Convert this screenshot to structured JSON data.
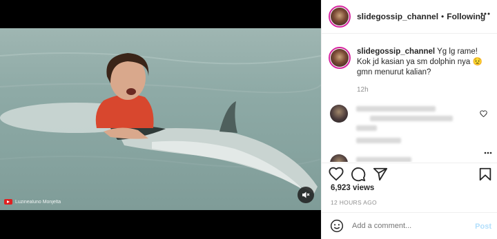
{
  "video": {
    "watermark": "Luzinealuno Monjelta",
    "icons": {
      "mute": "speaker-muted-icon",
      "watermark": "youtube-logo-icon"
    }
  },
  "header": {
    "username": "slidegossip_channel",
    "separator": "•",
    "follow_label": "Following",
    "more_icon": "more-horizontal-icon"
  },
  "caption": {
    "username": "slidegossip_channel",
    "text": "Yg lg rame! Kok jd kasian ya sm dolphin nya 😟 gmn menurut kalian?",
    "time": "12h"
  },
  "actions": {
    "icons": [
      "heart-icon",
      "comment-icon",
      "share-icon",
      "bookmark-icon"
    ]
  },
  "stats": {
    "views": "6,923 views",
    "time_ago": "12 HOURS AGO"
  },
  "composer": {
    "placeholder": "Add a comment...",
    "post_label": "Post",
    "emoji_icon": "emoji-icon"
  },
  "colors": {
    "follow_accent": "#262626",
    "post_disabled": "#b2dffc",
    "story_ring": "#d6249f"
  }
}
